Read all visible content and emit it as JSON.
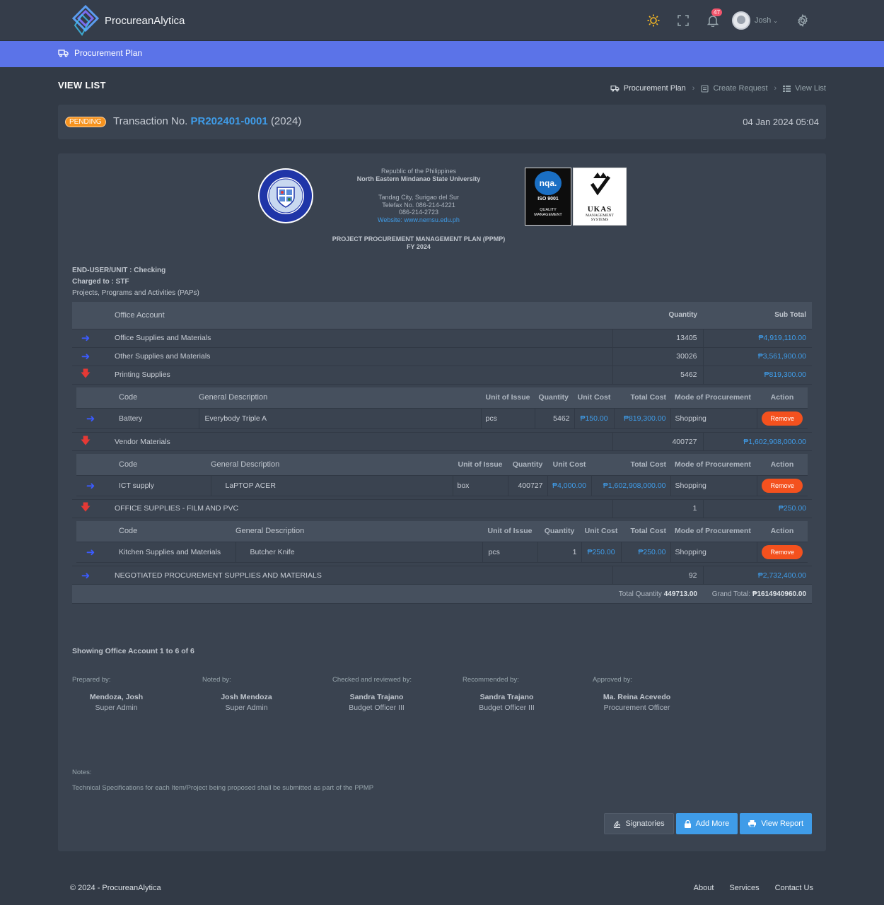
{
  "app": {
    "name": "ProcureanAlytica",
    "notifications": "47",
    "user": "Josh"
  },
  "nav": {
    "item": "Procurement Plan"
  },
  "page": {
    "title": "VIEW LIST"
  },
  "breadcrumb": [
    "Procurement Plan",
    "Create Request",
    "View List"
  ],
  "transaction": {
    "status": "PENDING",
    "label": "Transaction No.",
    "number": "PR202401-0001",
    "year": "(2024)",
    "date": "04 Jan 2024 05:04"
  },
  "header": {
    "line1": "Republic of the Philippines",
    "line2": "North Eastern Mindanao State University",
    "line3": "Tandag City, Surigao del Sur",
    "line4": "Telefax No. 086-214-4221",
    "line5": "086-214-2723",
    "website": "Website: www.nemsu.edu.ph",
    "plan_title": "PROJECT PROCUREMENT MANAGEMENT PLAN (PPMP)",
    "fy": "FY 2024",
    "cert1_top": "nqa.",
    "cert1_mid": "ISO 9001",
    "cert1_bottom": "QUALITY MANAGEMENT",
    "cert2_top": "UKAS",
    "cert2_bottom": "MANAGEMENT SYSTEMS",
    "seal_text": "NORTH EASTERN MINDANAO STATE UNIVERSITY"
  },
  "meta": {
    "end_user": "END-USER/UNIT : Checking",
    "charged": "Charged to : STF",
    "paps": "Projects, Programs and Activities (PAPs)"
  },
  "main_table": {
    "headers": {
      "account": "Office Account",
      "quantity": "Quantity",
      "subtotal": "Sub Total"
    },
    "rows": [
      {
        "name": "Office Supplies and Materials",
        "qty": "13405",
        "sub": "₱4,919,110.00",
        "arrow": "right"
      },
      {
        "name": "Other Supplies and Materials",
        "qty": "30026",
        "sub": "₱3,561,900.00",
        "arrow": "right"
      },
      {
        "name": "Printing Supplies",
        "qty": "5462",
        "sub": "₱819,300.00",
        "arrow": "down"
      },
      {
        "name": "Vendor Materials",
        "qty": "400727",
        "sub": "₱1,602,908,000.00",
        "arrow": "down"
      },
      {
        "name": "OFFICE SUPPLIES - FILM AND PVC",
        "qty": "1",
        "sub": "₱250.00",
        "arrow": "down"
      },
      {
        "name": "NEGOTIATED PROCUREMENT SUPPLIES AND MATERIALS",
        "qty": "92",
        "sub": "₱2,732,400.00",
        "arrow": "right"
      }
    ],
    "totals": {
      "qty_label": "Total Quantity",
      "qty": "449713.00",
      "grand_label": "Grand Total:",
      "grand": "₱1614940960.00"
    }
  },
  "nested_headers": {
    "code": "Code",
    "desc": "General Description",
    "unit": "Unit of Issue",
    "qty": "Quantity",
    "ucost": "Unit Cost",
    "tcost": "Total Cost",
    "mode": "Mode of Procurement",
    "action": "Action"
  },
  "nested": [
    {
      "code": "Battery",
      "desc": "Everybody Triple A",
      "unit": "pcs",
      "qty": "5462",
      "ucost": "₱150.00",
      "tcost": "₱819,300.00",
      "mode": "Shopping",
      "action": "Remove"
    },
    {
      "code": "ICT supply",
      "desc": "LaPTOP ACER",
      "unit": "box",
      "qty": "400727",
      "ucost": "₱4,000.00",
      "tcost": "₱1,602,908,000.00",
      "mode": "Shopping",
      "action": "Remove"
    },
    {
      "code": "Kitchen Supplies and Materials",
      "desc": "Butcher Knife",
      "unit": "pcs",
      "qty": "1",
      "ucost": "₱250.00",
      "tcost": "₱250.00",
      "mode": "Shopping",
      "action": "Remove"
    }
  ],
  "showing": "Showing Office Account 1 to 6 of 6",
  "signatories": [
    {
      "label": "Prepared by:",
      "name": "Mendoza, Josh",
      "role": "Super Admin"
    },
    {
      "label": "Noted by:",
      "name": "Josh Mendoza",
      "role": "Super Admin"
    },
    {
      "label": "Checked and reviewed by:",
      "name": "Sandra Trajano",
      "role": "Budget Officer III"
    },
    {
      "label": "Recommended by:",
      "name": "Sandra Trajano",
      "role": "Budget Officer III"
    },
    {
      "label": "Approved by:",
      "name": "Ma. Reina Acevedo",
      "role": "Procurement Officer"
    }
  ],
  "notes": {
    "label": "Notes:",
    "text": "Technical Specifications for each Item/Project being proposed shall be submitted as part of the PPMP"
  },
  "buttons": {
    "signatories": "Signatories",
    "add_more": "Add More",
    "view_report": "View Report"
  },
  "footer": {
    "copyright": "© 2024 - ProcureanAlytica",
    "links": [
      "About",
      "Services",
      "Contact Us"
    ]
  },
  "colors": {
    "accent": "#5b73e8",
    "link": "#3f9ce8",
    "danger": "#f4511e",
    "warning": "#f7931e",
    "arrow_right": "#3b5bff",
    "arrow_down": "#e53935"
  }
}
